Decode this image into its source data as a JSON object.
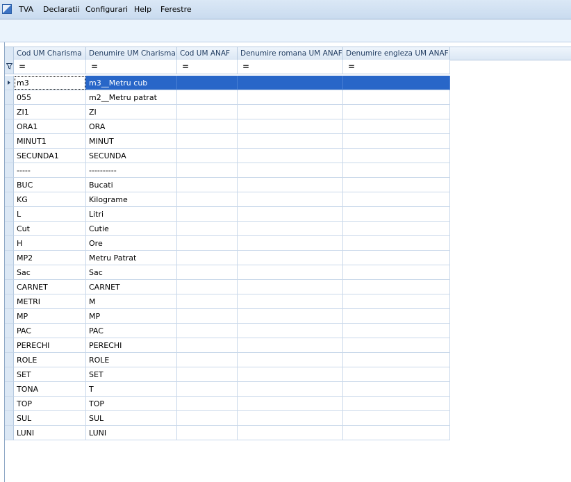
{
  "menu": {
    "items": [
      "TVA",
      "Declaratii",
      "Configurari",
      "Help",
      "Ferestre"
    ]
  },
  "grid": {
    "columns": [
      "Cod UM Charisma",
      "Denumire UM Charisma",
      "Cod UM ANAF",
      "Denumire romana UM ANAF",
      "Denumire engleza UM ANAF"
    ],
    "filter_symbol": "=",
    "rows": [
      [
        "m3",
        "m3__Metru cub",
        "",
        "",
        ""
      ],
      [
        "055",
        "m2__Metru patrat",
        "",
        "",
        ""
      ],
      [
        "ZI1",
        "ZI",
        "",
        "",
        ""
      ],
      [
        "ORA1",
        "ORA",
        "",
        "",
        ""
      ],
      [
        "MINUT1",
        "MINUT",
        "",
        "",
        ""
      ],
      [
        "SECUNDA1",
        "SECUNDA",
        "",
        "",
        ""
      ],
      [
        "-----",
        "----------",
        "",
        "",
        ""
      ],
      [
        "BUC",
        "Bucati",
        "",
        "",
        ""
      ],
      [
        "KG",
        "Kilograme",
        "",
        "",
        ""
      ],
      [
        "L",
        "Litri",
        "",
        "",
        ""
      ],
      [
        "Cut",
        "Cutie",
        "",
        "",
        ""
      ],
      [
        "H",
        "Ore",
        "",
        "",
        ""
      ],
      [
        "MP2",
        "Metru Patrat",
        "",
        "",
        ""
      ],
      [
        "Sac",
        "Sac",
        "",
        "",
        ""
      ],
      [
        "CARNET",
        "CARNET",
        "",
        "",
        ""
      ],
      [
        "METRI",
        "M",
        "",
        "",
        ""
      ],
      [
        "MP",
        "MP",
        "",
        "",
        ""
      ],
      [
        "PAC",
        "PAC",
        "",
        "",
        ""
      ],
      [
        "PERECHI",
        "PERECHI",
        "",
        "",
        ""
      ],
      [
        "ROLE",
        "ROLE",
        "",
        "",
        ""
      ],
      [
        "SET",
        "SET",
        "",
        "",
        ""
      ],
      [
        "TONA",
        "T",
        "",
        "",
        ""
      ],
      [
        "TOP",
        "TOP",
        "",
        "",
        ""
      ],
      [
        "SUL",
        "SUL",
        "",
        "",
        ""
      ],
      [
        "LUNI",
        "LUNI",
        "",
        "",
        ""
      ]
    ],
    "selected_row": 0
  },
  "colors": {
    "selection": "#2866c8",
    "header_text": "#1e3a5f",
    "menubar": "#c9dbef"
  },
  "icons": [
    "app-icon",
    "filter-icon",
    "row-pointer-icon"
  ]
}
